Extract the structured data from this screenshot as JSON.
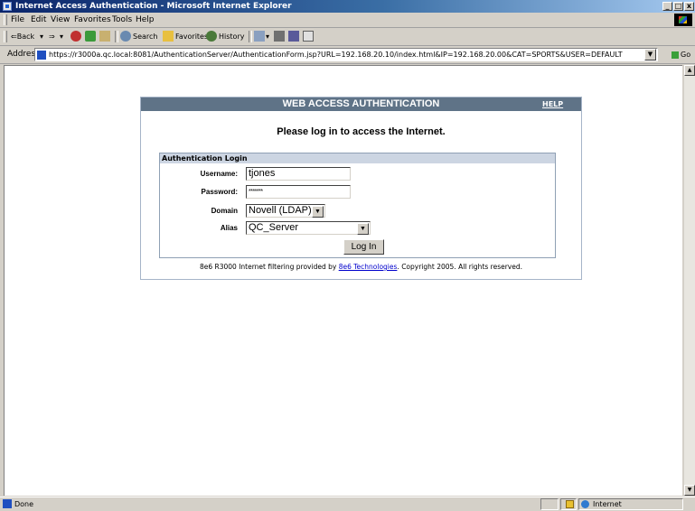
{
  "window": {
    "title": "Internet Access Authentication - Microsoft Internet Explorer",
    "minimize_glyph": "_",
    "restore_glyph": "□",
    "close_glyph": "x"
  },
  "menu": [
    "File",
    "Edit",
    "View",
    "Favorites",
    "Tools",
    "Help"
  ],
  "toolbar": {
    "back": "⇐Back",
    "forward": "⇒",
    "search": "Search",
    "favorites": "Favorites",
    "history": "History"
  },
  "address": {
    "label": "Address",
    "url": "https://r3000a.qc.local:8081/AuthenticationServer/AuthenticationForm.jsp?URL=192.168.20.10/index.html&IP=192.168.20.00&CAT=SPORTS&USER=DEFAULT",
    "go": "Go"
  },
  "page": {
    "header_title": "WEB ACCESS AUTHENTICATION",
    "help": "HELP",
    "prompt": "Please log in to access the Internet.",
    "section_title": "Authentication Login",
    "username_label": "Username:",
    "username_value": "tjones",
    "password_label": "Password:",
    "password_value": "*******",
    "domain_label": "Domain",
    "domain_value": "Novell (LDAP)",
    "alias_label": "Alias",
    "alias_value": "QC_Server",
    "login_button": "Log In",
    "copyright_prefix": "8e6 R3000 Internet filtering provided by ",
    "copyright_link": "8e6 Technologies",
    "copyright_suffix": ". Copyright 2005. All rights reserved."
  },
  "status": {
    "text": "Done",
    "zone": "Internet"
  },
  "colors": {
    "header_bg": "#5f7387",
    "section_bg": "#ccd5e2",
    "link": "#0000cc"
  }
}
